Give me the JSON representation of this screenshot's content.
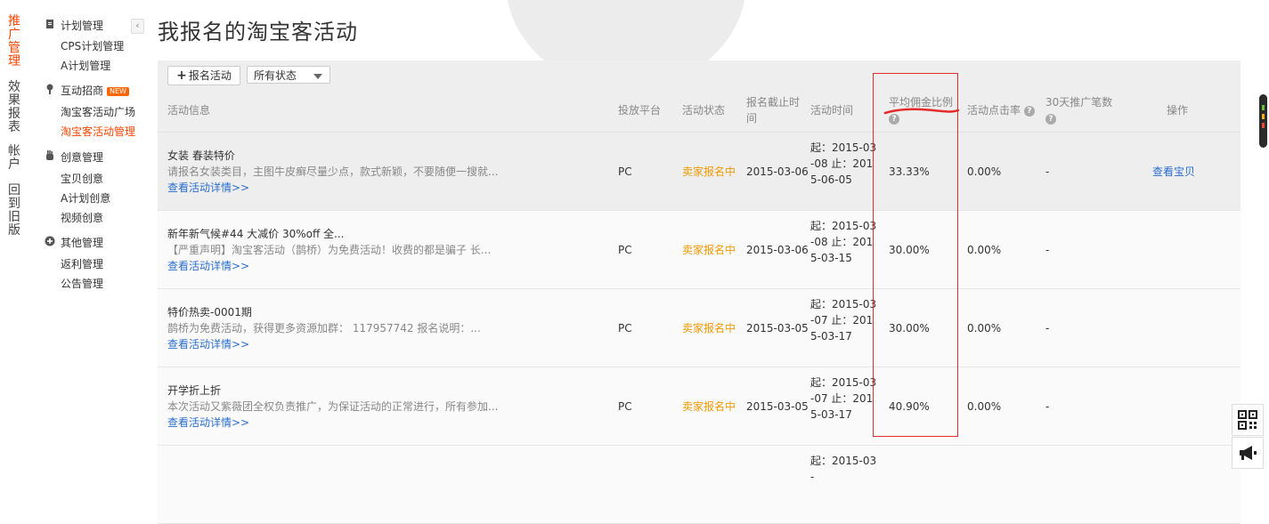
{
  "leftnav": {
    "items": [
      {
        "label": "推广管理",
        "active": true
      },
      {
        "label": "效果报表",
        "active": false
      },
      {
        "label": "帐户",
        "active": false
      },
      {
        "label": "回到旧版",
        "active": false
      }
    ]
  },
  "subnav": {
    "groups": [
      {
        "title": "计划管理",
        "icon": "doc-icon",
        "items": [
          "CPS计划管理",
          "A计划管理"
        ]
      },
      {
        "title": "互动招商",
        "icon": "pin-icon",
        "badge": "NEW",
        "items": [
          "淘宝客活动广场",
          "淘宝客活动管理"
        ]
      },
      {
        "title": "创意管理",
        "icon": "hand-icon",
        "items": [
          "宝贝创意",
          "A计划创意",
          "视频创意"
        ]
      },
      {
        "title": "其他管理",
        "icon": "plus-circle-icon",
        "items": [
          "返利管理",
          "公告管理"
        ]
      }
    ],
    "active_item": "淘宝客活动管理"
  },
  "page": {
    "title": "我报名的淘宝客活动"
  },
  "toolbar": {
    "signup_label": "报名活动",
    "status_filter": "所有状态"
  },
  "table": {
    "headers": {
      "info": "活动信息",
      "platform": "投放平台",
      "status": "活动状态",
      "deadline": "报名截止时间",
      "time": "活动时间",
      "commission": "平均佣金比例",
      "ctr": "活动点击率",
      "sales30": "30天推广笔数",
      "ops": "操作"
    },
    "rows": [
      {
        "title": "女装 春装特价",
        "desc": "请报名女装类目，主图牛皮癣尽量少点，款式新颖，不要随便一搜就...",
        "link": "查看活动详情>>",
        "platform": "PC",
        "status": "卖家报名中",
        "deadline": "2015-03-06",
        "time": "起：2015-03-08 止：2015-06-05",
        "commission": "33.33%",
        "ctr": "0.00%",
        "sales30": "-",
        "op": "查看宝贝"
      },
      {
        "title": "新年新气候#44 大减价 30%off 全...",
        "desc": "【严重声明】淘宝客活动（鹊桥）为免费活动！收费的都是骗子 长...",
        "link": "查看活动详情>>",
        "platform": "PC",
        "status": "卖家报名中",
        "deadline": "2015-03-06",
        "time": "起：2015-03-08 止：2015-03-15",
        "commission": "30.00%",
        "ctr": "0.00%",
        "sales30": "-",
        "op": ""
      },
      {
        "title": "特价热卖-0001期",
        "desc": "鹊桥为免费活动，获得更多资源加群： 117957742 报名说明：...",
        "link": "查看活动详情>>",
        "platform": "PC",
        "status": "卖家报名中",
        "deadline": "2015-03-05",
        "time": "起：2015-03-07 止：2015-03-17",
        "commission": "30.00%",
        "ctr": "0.00%",
        "sales30": "-",
        "op": ""
      },
      {
        "title": "开学折上折",
        "desc": "本次活动又紫薇团全权负责推广，为保证活动的正常进行，所有参加...",
        "link": "查看活动详情>>",
        "platform": "PC",
        "status": "卖家报名中",
        "deadline": "2015-03-05",
        "time": "起：2015-03-07 止：2015-03-17",
        "commission": "40.90%",
        "ctr": "0.00%",
        "sales30": "-",
        "op": ""
      },
      {
        "title": "",
        "desc": "",
        "link": "",
        "platform": "",
        "status": "",
        "deadline": "",
        "time": "起：2015-03-",
        "commission": "",
        "ctr": "",
        "sales30": "",
        "op": ""
      }
    ]
  },
  "side": {
    "qr_icon": "qr-code-icon",
    "notice_icon": "megaphone-icon"
  },
  "colors": {
    "accent": "#ff4400",
    "link": "#2a6ecf",
    "status": "#f39800",
    "annotation": "#e62b2b"
  }
}
